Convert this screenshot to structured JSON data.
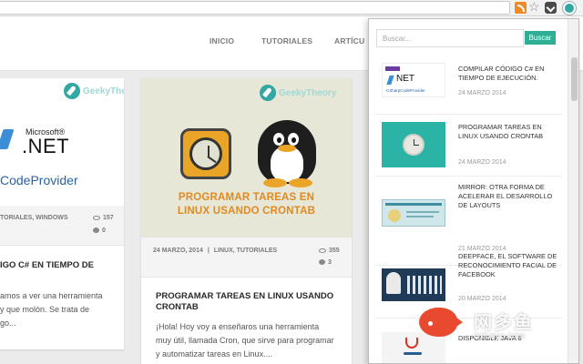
{
  "browser": {
    "icons": [
      "rss-icon",
      "bookmark-star-icon",
      "pocket-icon",
      "extension-icon"
    ]
  },
  "nav": {
    "items": [
      "INICIO",
      "TUTORIALES",
      "ARTÍCU"
    ]
  },
  "cards": [
    {
      "brand": "GeekyTheory",
      "thumb_small": "Microsoft®",
      "thumb_big": ".NET",
      "thumb_sub": "CodeProvider",
      "categories": "TORIALES, WINDOWS",
      "views": "157",
      "comments": "0",
      "title": "IGO C# EN TIEMPO DE",
      "excerpt": [
        "amos a ver una herramienta",
        "y que molón. Se trata de",
        "go..."
      ]
    },
    {
      "brand": "GeekyTheory",
      "thumb_text": [
        "PROGRAMAR TAREAS EN",
        "LINUX USANDO CRONTAB"
      ],
      "date": "24 MARZO, 2014",
      "categories": "LINUX, TUTORIALES",
      "views": "355",
      "comments": "3",
      "title": "PROGRAMAR TAREAS EN LINUX USANDO CRONTAB",
      "excerpt": [
        "¡Hola! Hoy voy a enseñaros una herramienta",
        "muy útil, llamada Cron, que sirve para programar",
        "y automatizar tareas en Linux...."
      ]
    }
  ],
  "popup": {
    "search_placeholder": "Buscar...",
    "search_button": "Buscar",
    "items": [
      {
        "title": "COMPILAR CÓDIGO C# EN TIEMPO DE EJECUCIÓN.",
        "date": "24 MARZO 2014",
        "thumb": "dotnet"
      },
      {
        "title": "PROGRAMAR TAREAS EN LINUX USANDO CRONTAB",
        "date": "24 MARZO 2014",
        "thumb": "clock"
      },
      {
        "title": "MIRROR: OTRA FORMA DE ACELERAR EL DESARROLLO DE LAYOUTS",
        "date": "21 MARZO 2014",
        "thumb": "mirror"
      },
      {
        "title": "DEEPFACE, EL SOFTWARE DE RECONOCIMIENTO FACIAL DE FACEBOOK",
        "date": "20 MARZO 2014",
        "thumb": "faces"
      },
      {
        "title": "DISPONIBLE JAVA 8",
        "date": "",
        "thumb": "java"
      }
    ],
    "thumb_labels": {
      "dotnet_small": "NET",
      "dotnet_sub": "CSharpCodeProvider"
    }
  },
  "watermark": {
    "cn": "网多鱼",
    "en": "wduoyu.com"
  },
  "colors": {
    "accent": "#2eae95",
    "teal": "#33a7a4",
    "orange": "#e08a20"
  }
}
